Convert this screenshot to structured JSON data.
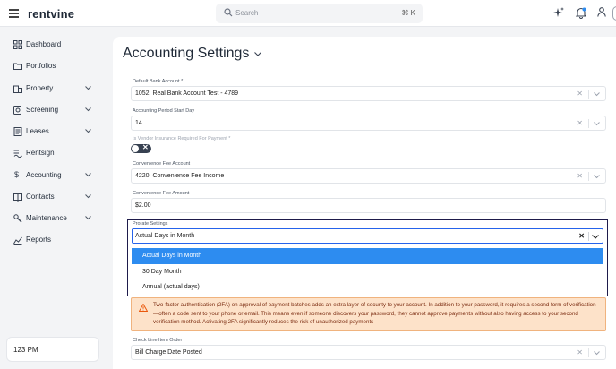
{
  "topbar": {
    "brand": "rentvine",
    "search_placeholder": "Search",
    "search_shortcut": "⌘ K"
  },
  "sidebar": {
    "items": [
      {
        "label": "Dashboard",
        "icon": "dashboard-icon",
        "expandable": false
      },
      {
        "label": "Portfolios",
        "icon": "folder-icon",
        "expandable": false
      },
      {
        "label": "Property",
        "icon": "building-icon",
        "expandable": true
      },
      {
        "label": "Screening",
        "icon": "screening-icon",
        "expandable": true
      },
      {
        "label": "Leases",
        "icon": "document-icon",
        "expandable": true
      },
      {
        "label": "Rentsign",
        "icon": "signature-icon",
        "expandable": false
      },
      {
        "label": "Accounting",
        "icon": "dollar-icon",
        "expandable": true
      },
      {
        "label": "Contacts",
        "icon": "book-icon",
        "expandable": true
      },
      {
        "label": "Maintenance",
        "icon": "wrench-icon",
        "expandable": true
      },
      {
        "label": "Reports",
        "icon": "chart-icon",
        "expandable": false
      }
    ],
    "clock": "123 PM"
  },
  "main": {
    "title": "Accounting Settings",
    "default_bank": {
      "label": "Default Bank Account *",
      "value": "1052: Real Bank Account Test - 4789"
    },
    "period_start": {
      "label": "Accounting Period Start Day",
      "value": "14"
    },
    "vendor_insurance": {
      "label": "Is Vendor Insurance Required For Payment *",
      "value": false
    },
    "conv_fee_account": {
      "label": "Convenience Fee Account",
      "value": "4220: Convenience Fee Income"
    },
    "conv_fee_amount": {
      "label": "Convenience Fee Amount",
      "value": "$2.00"
    },
    "prorate": {
      "label": "Prorate Settings",
      "value": "Actual Days in Month",
      "options": [
        "Actual Days in Month",
        "30 Day Month",
        "Annual (actual days)"
      ]
    },
    "warning": "Two-factor authentication (2FA) on approval of payment batches adds an extra layer of security to your account. In addition to your password, it requires a second form of verification—often a code sent to your phone or email. This means even if someone discovers your password, they cannot approve payments without also having access to your second verification method. Activating 2FA significantly reduces the risk of unauthorized payments",
    "check_line": {
      "label": "Check Line Item Order",
      "value": "Bill Charge Date Posted"
    }
  },
  "colors": {
    "accent": "#2d8cf0",
    "warning_bg": "#fde2c9",
    "sidebar_bg": "#f3f4f6"
  }
}
